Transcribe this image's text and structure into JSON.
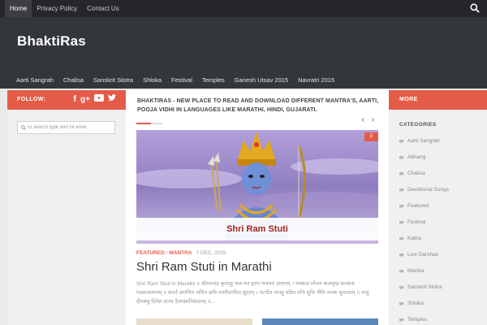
{
  "topnav": {
    "items": [
      {
        "label": "Home",
        "active": true
      },
      {
        "label": "Privacy Policy",
        "active": false
      },
      {
        "label": "Contact Us",
        "active": false
      }
    ],
    "search_icon": "search-icon"
  },
  "header": {
    "site_title": "BhaktiRas"
  },
  "mainnav": {
    "items": [
      "Aarti Sangrah",
      "Chalisa",
      "Sanskrit Stotra",
      "Shloka",
      "Festival",
      "Temples",
      "Ganesh Utsav 2015",
      "Navratri 2015"
    ]
  },
  "left_sidebar": {
    "follow_label": "FOLLOW:",
    "social_icons": [
      "facebook-icon",
      "google-plus-icon",
      "youtube-icon",
      "twitter-icon"
    ],
    "search_placeholder": "To search type and hit enter"
  },
  "main": {
    "tagline": "BHAKTIRAS - NEW PLACE TO READ AND DOWNLOAD DIFFERENT MANTRA'S, AARTI, POOJA VIDHI IN LANGUAGES LIKE MARATHI, HINDI, GUJARATI.",
    "featured": {
      "image_caption": "Shri Ram Stuti",
      "comment_count": "0",
      "category_1": "FEATURED",
      "separator": "/",
      "category_2": "MANTRA",
      "date": "7 DEC, 2015",
      "title": "Shri Ram Stuti in Marathi",
      "excerpt": "Shri Ram Stuti in Marathi ॥ श्रीरामचंद्र कृपाळु भज मन हरण भवभय दारुणम् । नवकंज लोचन कंजमुख करकंज पदकंजारुणम् ॥ कंदर्प अगणित अमित छवि नवनीलनीरद सुंदरम् । पटपीत मानहु तडित रुचि शुचि नौमि जनक सुतावरम् ॥ भजु दीनबंधु दिनेश दानव दैत्यवंशनिकंदनम् ॥..."
    },
    "colors": {
      "accent": "#e45c47"
    }
  },
  "right_sidebar": {
    "more_label": "MORE",
    "categories_heading": "CATEGORIES",
    "categories": [
      "Aarti Sangrah",
      "Abhang",
      "Chalisa",
      "Devotional Songs",
      "Featured",
      "Festival",
      "Katha",
      "Live Darshan",
      "Mantra",
      "Sanskrit Stotra",
      "Shloka",
      "Temples"
    ]
  }
}
